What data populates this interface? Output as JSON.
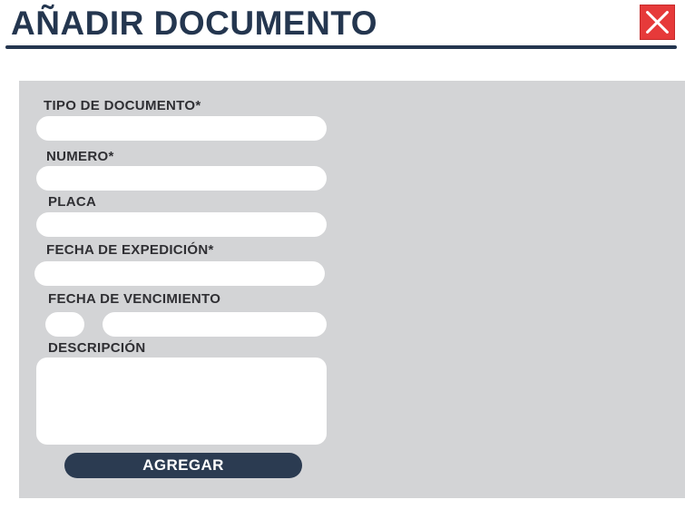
{
  "header": {
    "title": "AÑADIR DOCUMENTO",
    "close_icon": "close-x-icon",
    "close_color": "#e63a3a",
    "title_color": "#24364f"
  },
  "form": {
    "tipo_documento_label": "TIPO DE DOCUMENTO*",
    "tipo_documento_value": "",
    "numero_label": "NUMERO*",
    "numero_value": "",
    "placa_label": "PLACA",
    "placa_value": "",
    "fecha_expedicion_label": "FECHA DE EXPEDICIÓN*",
    "fecha_expedicion_value": "",
    "fecha_vencimiento_label": "FECHA DE VENCIMIENTO",
    "fecha_vencimiento_small_value": "",
    "fecha_vencimiento_value": "",
    "descripcion_label": "DESCRIPCIÓN",
    "descripcion_value": "",
    "submit_label": "AGREGAR",
    "panel_color": "#d3d4d6",
    "button_color": "#2b3b51"
  }
}
